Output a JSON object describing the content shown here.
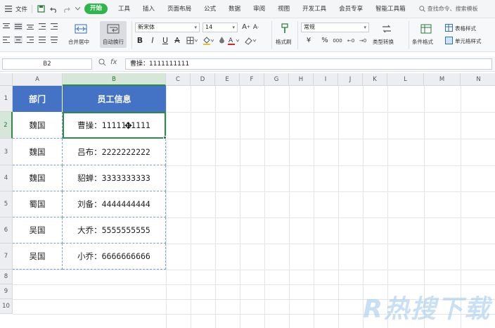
{
  "menubar": {
    "file_label": "文件",
    "tabs": [
      "开始",
      "工具",
      "插入",
      "页面布局",
      "公式",
      "数据",
      "审阅",
      "视图",
      "开发工具",
      "会员专享",
      "智能工具箱"
    ],
    "active_tab": "开始",
    "search_text": "查找命令、搜索模板"
  },
  "ribbon": {
    "merge_label": "合并居中",
    "wrap_label": "自动换行",
    "font_name": "新宋体",
    "font_size": "14",
    "bold": "B",
    "italic": "I",
    "underline": "U",
    "strike": "A",
    "format_painter": "格式刷",
    "number_format": "常规",
    "currency": "¥",
    "percent": "%",
    "thousands": "000",
    "type_convert": "类型转换",
    "cond_format": "条件格式",
    "table_style": "表格样式",
    "cell_style": "单元格样式"
  },
  "formula_bar": {
    "cell_ref": "B2",
    "fx": "fx",
    "value": "曹操：1111111111"
  },
  "columns": [
    "A",
    "B",
    "C",
    "D",
    "E",
    "F",
    "G",
    "H",
    "I",
    "J",
    "K",
    "L",
    "M",
    "N"
  ],
  "rows": [
    "1",
    "2",
    "3",
    "4",
    "5",
    "6",
    "7",
    "8",
    "9",
    "10"
  ],
  "sheet": {
    "header": {
      "dept": "部门",
      "info": "员工信息"
    },
    "records": [
      {
        "dept": "魏国",
        "info": "曹操：1111111111"
      },
      {
        "dept": "魏国",
        "info": "吕布：2222222222"
      },
      {
        "dept": "魏国",
        "info": "貂蝉：3333333333"
      },
      {
        "dept": "蜀国",
        "info": "刘备：4444444444"
      },
      {
        "dept": "吴国",
        "info": "大乔：5555555555"
      },
      {
        "dept": "吴国",
        "info": "小乔：6666666666"
      }
    ]
  },
  "selected_cell": "B2",
  "watermark": "R热搜下载",
  "colors": {
    "accent": "#2eb64c",
    "header_fill": "#4472c4",
    "selection": "#2e8b47"
  }
}
